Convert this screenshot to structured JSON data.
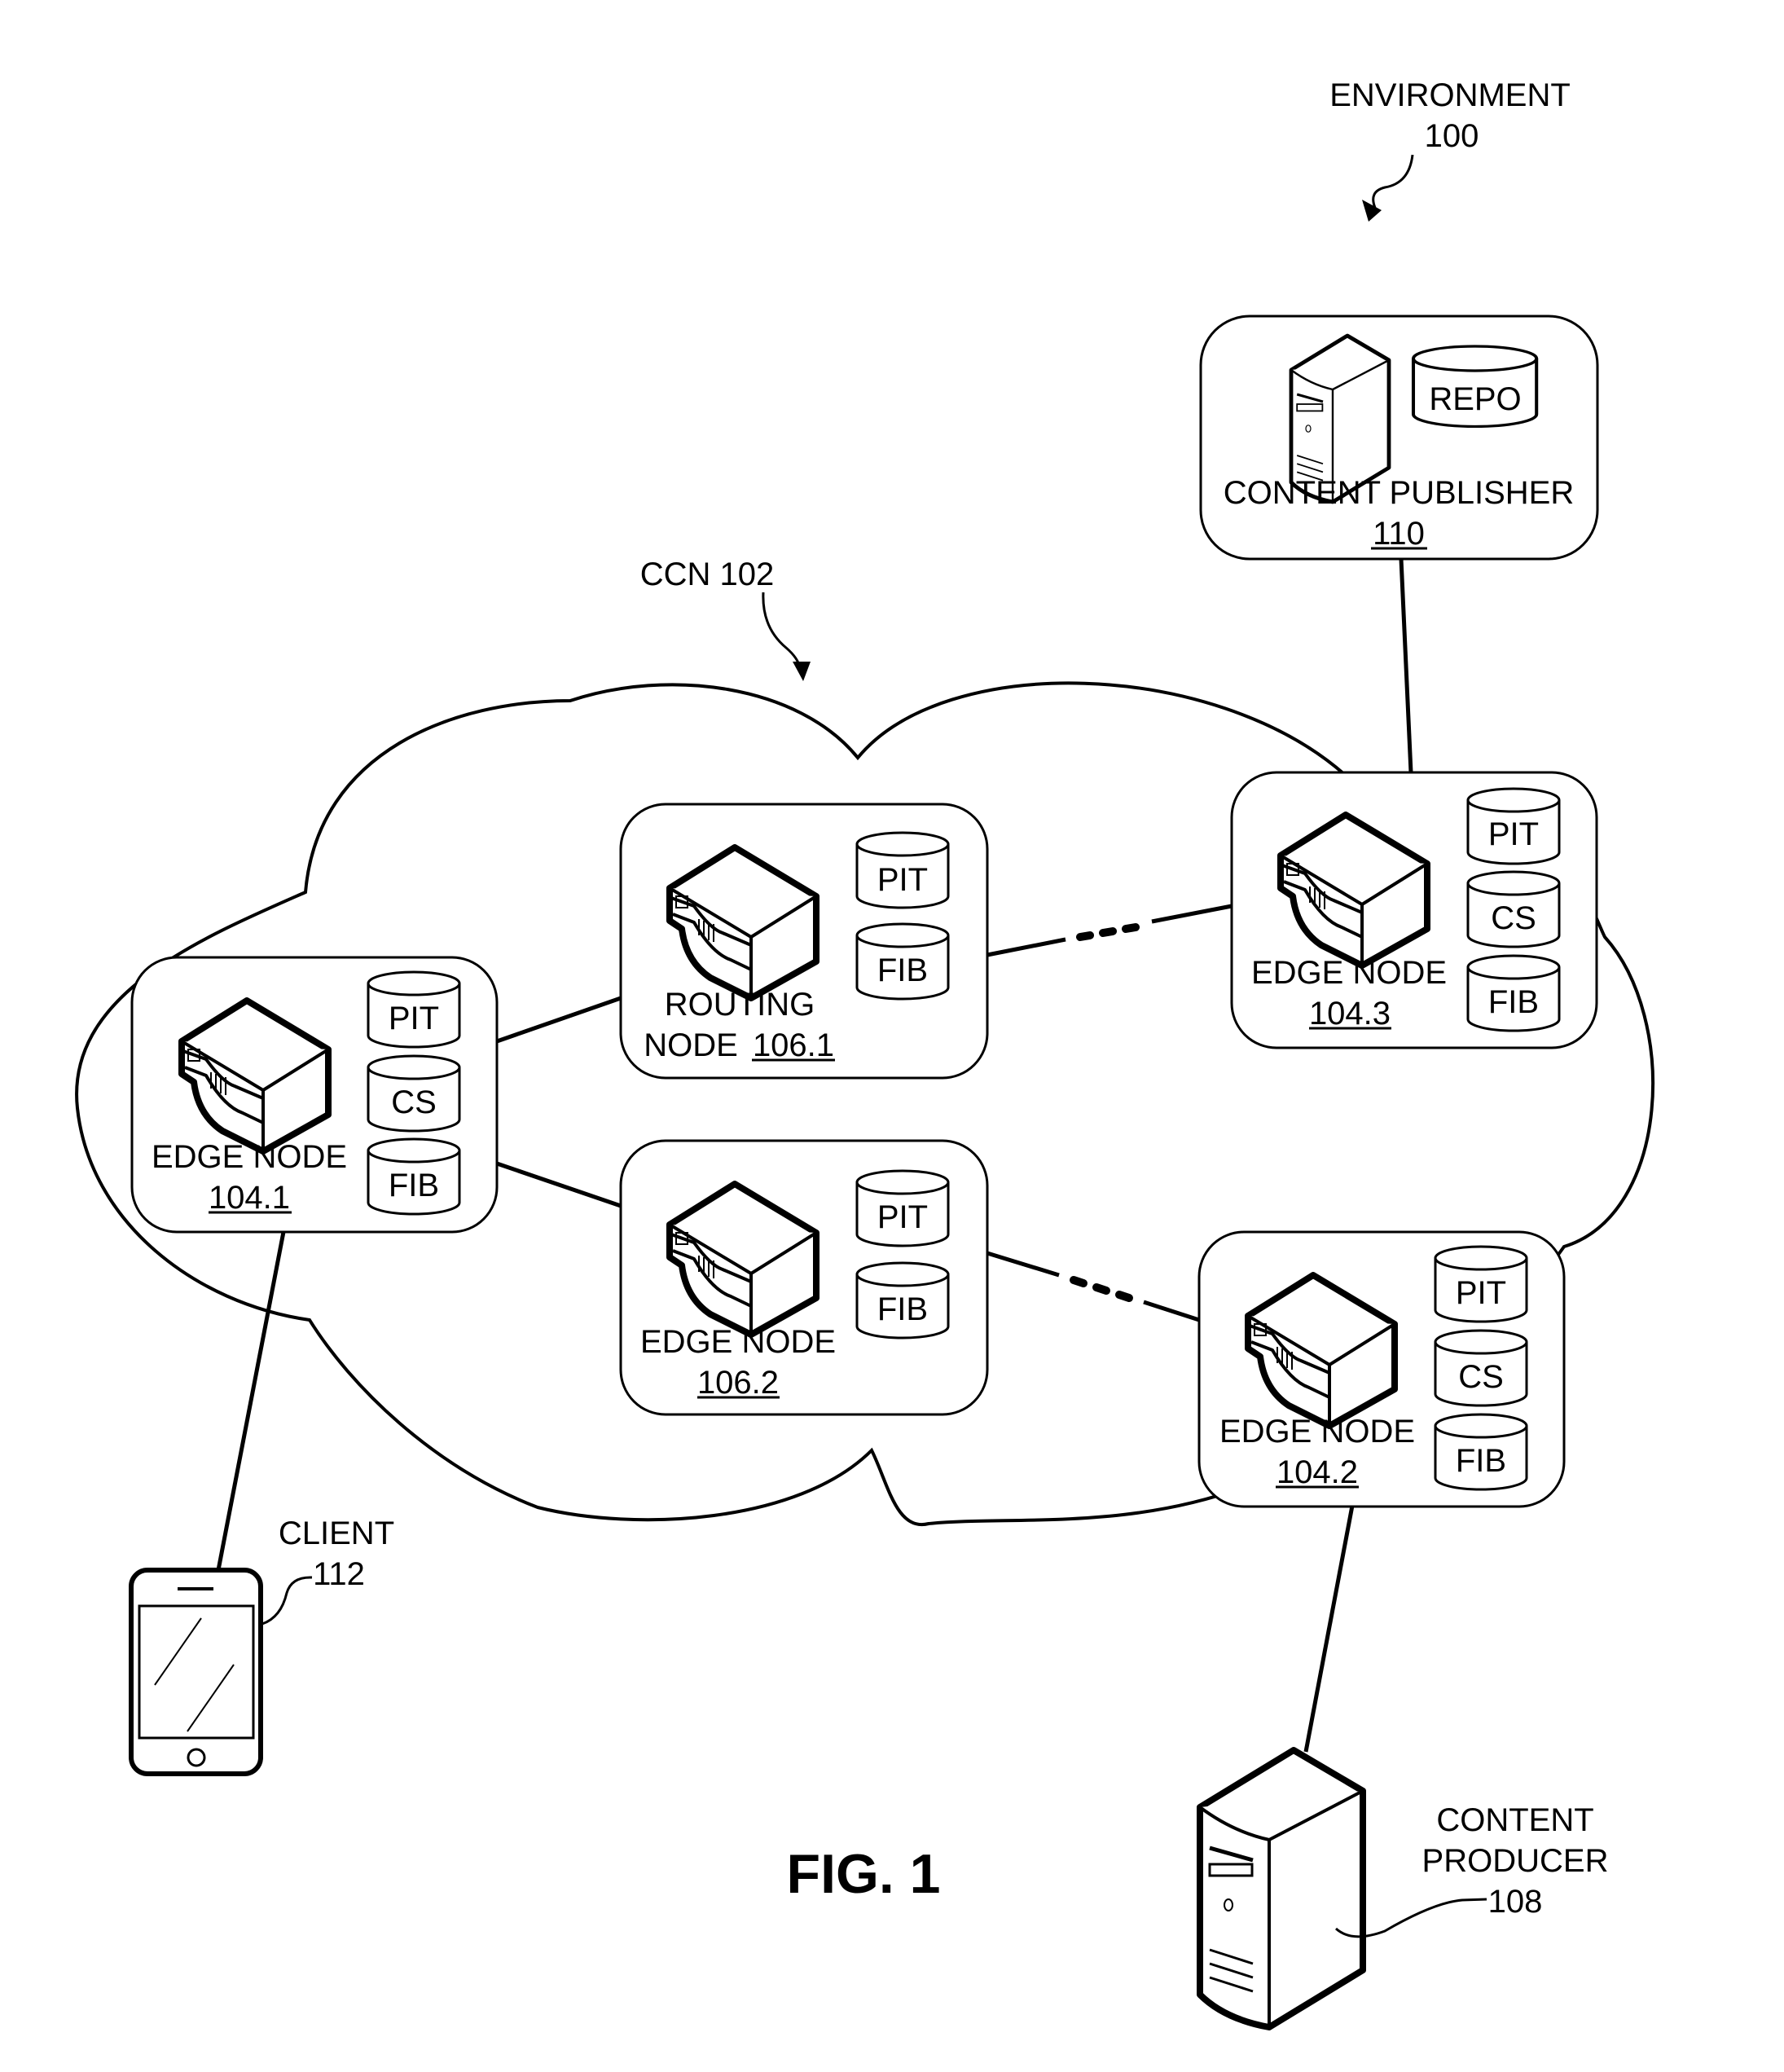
{
  "figure": {
    "title": "FIG. 1",
    "environment": {
      "label": "ENVIRONMENT",
      "ref": "100"
    },
    "network": {
      "label": "CCN 102"
    },
    "content_publisher": {
      "label": "CONTENT PUBLISHER",
      "ref": "110",
      "store": "REPO"
    },
    "nodes": [
      {
        "id": "edge-104-1",
        "line1": "EDGE NODE",
        "ref": "104.1",
        "tables": [
          "PIT",
          "CS",
          "FIB"
        ]
      },
      {
        "id": "routing-106-1",
        "line1": "ROUTING",
        "line2": "NODE",
        "ref": "106.1",
        "tables": [
          "PIT",
          "FIB"
        ]
      },
      {
        "id": "edge-106-2",
        "line1": "EDGE NODE",
        "ref": "106.2",
        "tables": [
          "PIT",
          "FIB"
        ]
      },
      {
        "id": "edge-104-3",
        "line1": "EDGE NODE",
        "ref": "104.3",
        "tables": [
          "PIT",
          "CS",
          "FIB"
        ]
      },
      {
        "id": "edge-104-2",
        "line1": "EDGE NODE",
        "ref": "104.2",
        "tables": [
          "PIT",
          "CS",
          "FIB"
        ]
      }
    ],
    "client": {
      "label": "CLIENT",
      "ref": "112"
    },
    "content_producer": {
      "line1": "CONTENT",
      "line2": "PRODUCER",
      "ref": "108"
    }
  }
}
